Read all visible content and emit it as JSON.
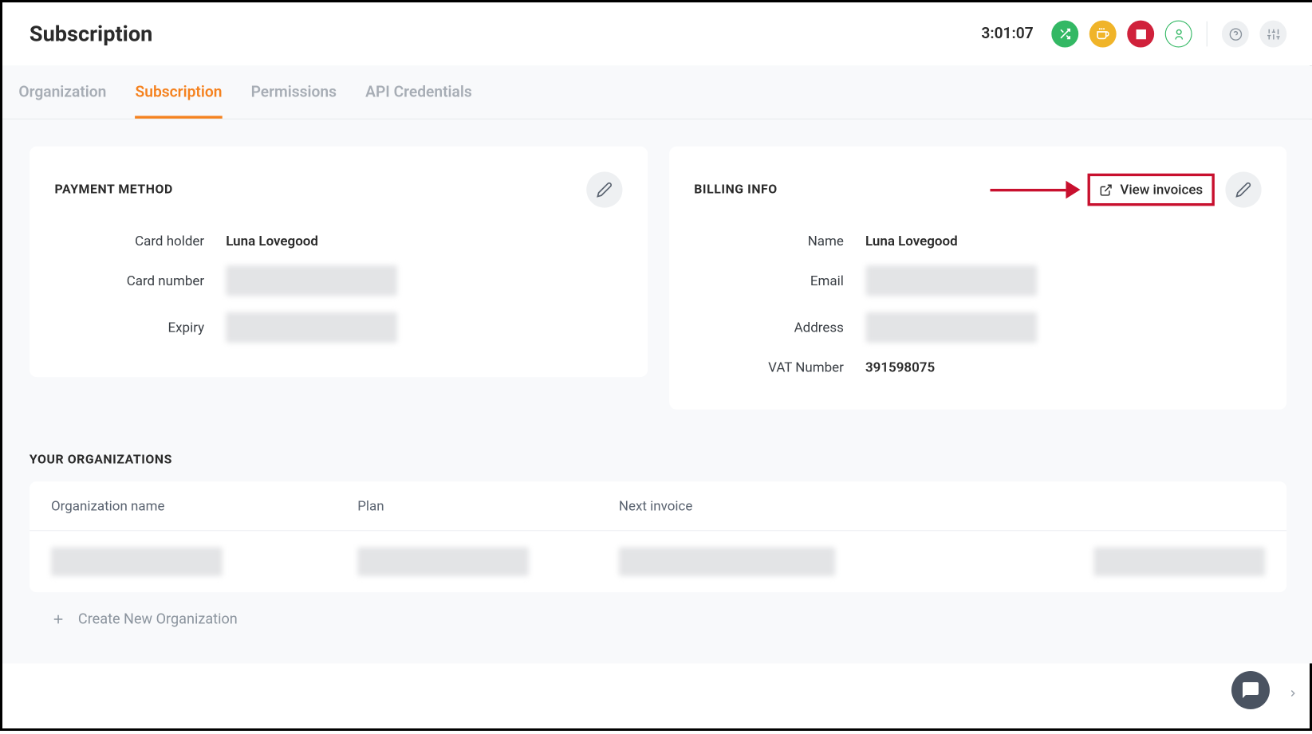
{
  "header": {
    "title": "Subscription",
    "timer": "3:01:07"
  },
  "tabs": {
    "organization": "Organization",
    "subscription": "Subscription",
    "permissions": "Permissions",
    "api_credentials": "API Credentials"
  },
  "payment_method": {
    "title": "PAYMENT METHOD",
    "labels": {
      "card_holder": "Card holder",
      "card_number": "Card number",
      "expiry": "Expiry"
    },
    "card_holder": "Luna Lovegood"
  },
  "billing_info": {
    "title": "BILLING INFO",
    "view_invoices": "View invoices",
    "labels": {
      "name": "Name",
      "email": "Email",
      "address": "Address",
      "vat": "VAT Number"
    },
    "name": "Luna Lovegood",
    "vat": "391598075"
  },
  "organizations": {
    "section_title": "YOUR ORGANIZATIONS",
    "columns": {
      "name": "Organization name",
      "plan": "Plan",
      "invoice": "Next invoice"
    },
    "create_label": "Create New Organization"
  }
}
